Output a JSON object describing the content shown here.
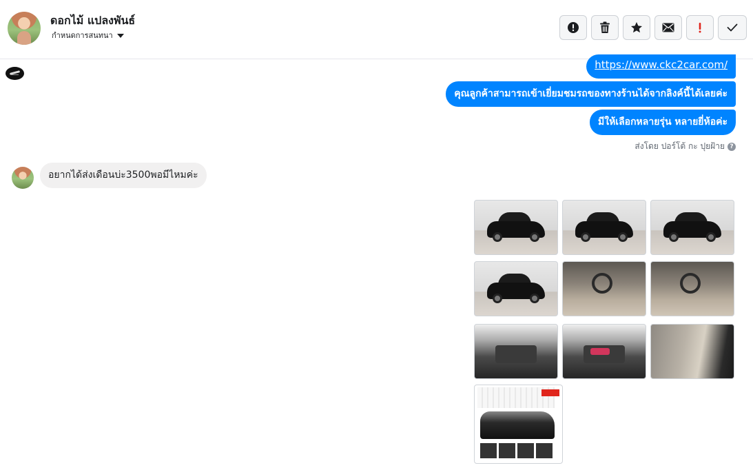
{
  "header": {
    "contact_name": "ดอกไม้ แปลงพันธ์",
    "assign_label": "กำหนดการสนทนา",
    "toolbar": [
      {
        "name": "spam-button",
        "icon": "exclamation-circle-icon"
      },
      {
        "name": "delete-button",
        "icon": "trash-icon"
      },
      {
        "name": "star-button",
        "icon": "star-icon"
      },
      {
        "name": "mark-unread-button",
        "icon": "envelope-icon"
      },
      {
        "name": "follow-up-button",
        "icon": "red-exclamation-icon"
      },
      {
        "name": "mark-done-button",
        "icon": "checkmark-icon"
      }
    ]
  },
  "colors": {
    "outgoing_bubble": "#0084ff",
    "incoming_bubble": "#f1f0f0",
    "follow_up_red": "#e0261d"
  },
  "messages": {
    "outgoing": [
      "https://www.ckc2car.com/",
      "คุณลูกค้าสามารถเข้าเยี่ยมชมรถของทางร้านได้จากลิงค์นี้ได้เลยค่ะ",
      "มีให้เลือกหลายรุ่น หลายยี่ห้อค่ะ"
    ],
    "sent_by": "ส่งโดย ปอร์โต้ กะ ปุยฝ้าย",
    "incoming": "อยากได้ส่งเดือนบ่ะ3500พอมีไหมค่ะ"
  },
  "photos": {
    "count": 10,
    "items": [
      {
        "kind": "car-exterior-front"
      },
      {
        "kind": "car-exterior-rear"
      },
      {
        "kind": "car-exterior-side"
      },
      {
        "kind": "car-exterior-side"
      },
      {
        "kind": "car-interior-dashboard"
      },
      {
        "kind": "car-interior-front-seats"
      },
      {
        "kind": "engine-bay"
      },
      {
        "kind": "engine-bay-closeup"
      },
      {
        "kind": "door-panel"
      },
      {
        "kind": "sale-poster"
      }
    ]
  }
}
